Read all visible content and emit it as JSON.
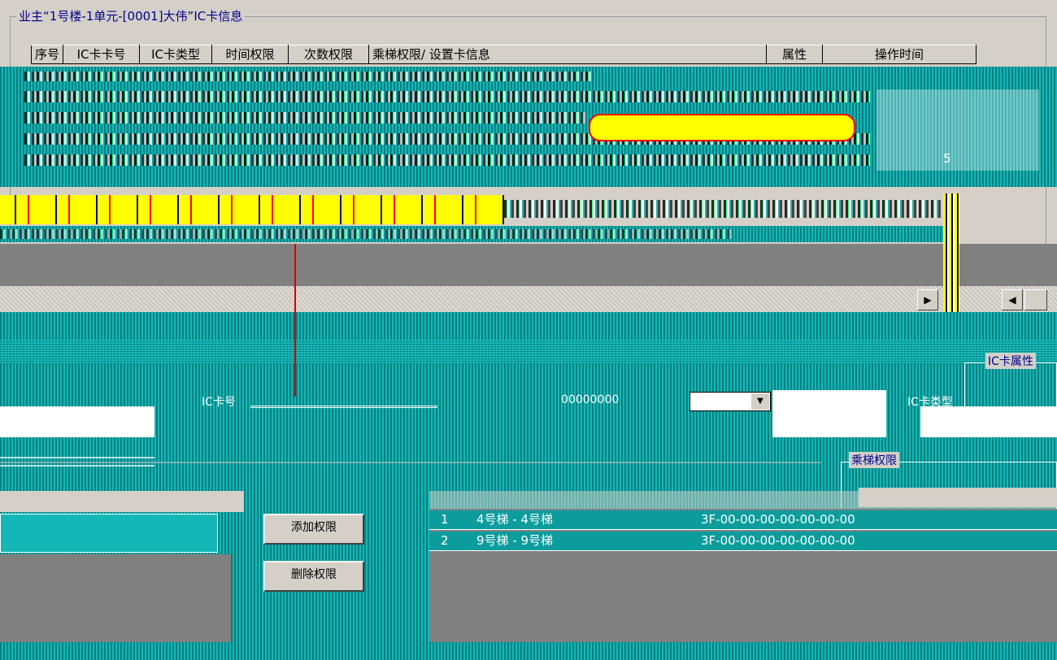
{
  "group": {
    "title": "业主“1号楼-1单元-[0001]大伟”IC卡信息"
  },
  "card_table": {
    "columns": [
      "序号",
      "IC卡卡号",
      "IC卡类型",
      "时间权限",
      "次数权限",
      "乘梯权限/ 设置卡信息",
      "属性",
      "操作时间"
    ],
    "visible_cells": [
      "5"
    ]
  },
  "fields": {
    "ic_card_label": "IC卡号",
    "elevator_number_value": "00000000",
    "ic_card_type_label": "IC卡类型"
  },
  "panels": {
    "ic_property_title": "IC卡属性",
    "elevator_perm_title": "乘梯权限"
  },
  "buttons": {
    "add_permission": "添加权限",
    "delete_permission": "删除权限"
  },
  "elevator_list": {
    "rows": [
      {
        "index": "1",
        "name": "4号梯 - 4号梯",
        "code": "3F-00-00-00-00-00-00-00"
      },
      {
        "index": "2",
        "name": "9号梯 - 9号梯",
        "code": "3F-00-00-00-00-00-00-00"
      }
    ]
  },
  "scroll": {
    "left_arrow": "◀",
    "right_arrow": "▶"
  },
  "colors": {
    "teal": "#0c8f8f",
    "highlight_yellow": "#ffff00",
    "accent_red": "#ff0000",
    "panel_gray": "#d4d0c8"
  }
}
